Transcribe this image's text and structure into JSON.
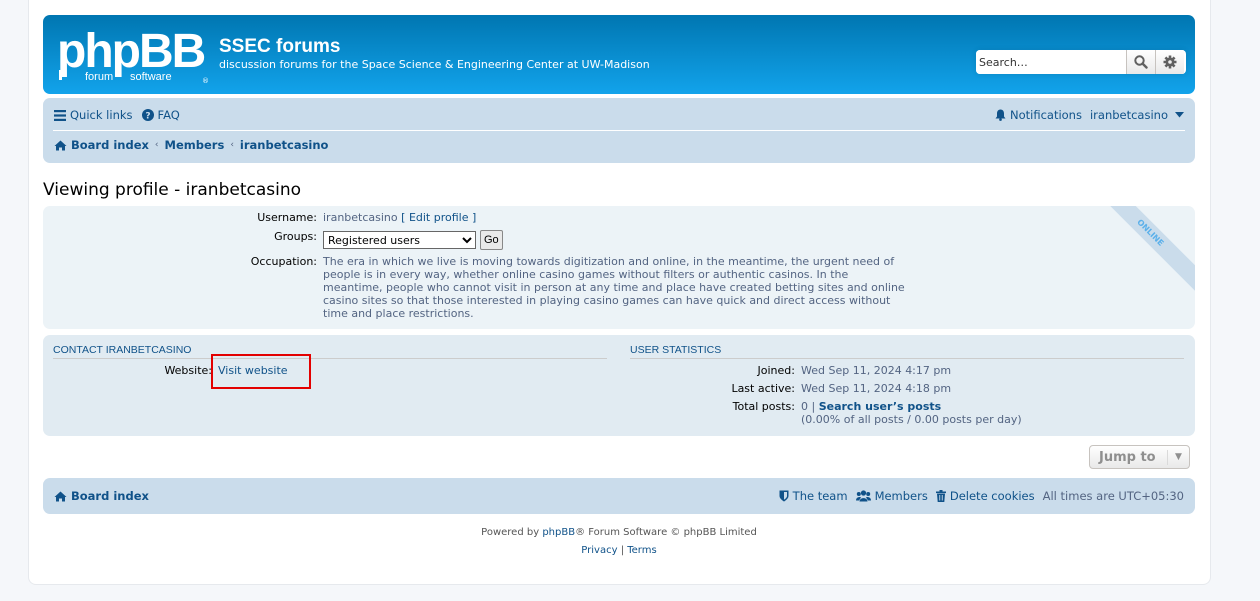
{
  "header": {
    "logo": {
      "main": "phpBB",
      "sub_left": "forum",
      "sub_right": "software"
    },
    "site_title": "SSEC forums",
    "site_description": "discussion forums for the Space Science & Engineering Center at UW-Madison",
    "search": {
      "placeholder": "Search…",
      "value": "",
      "search_icon": "search-icon",
      "settings_icon": "gear-icon"
    }
  },
  "navbar": {
    "quick_links": "Quick links",
    "faq": "FAQ",
    "notifications": "Notifications",
    "username": "iranbetcasino",
    "breadcrumbs": [
      "Board index",
      "Members",
      "iranbetcasino"
    ]
  },
  "page": {
    "title": "Viewing profile - iranbetcasino"
  },
  "profile": {
    "status_ribbon": "ONLINE",
    "fields": {
      "username_label": "Username:",
      "username_value": "iranbetcasino",
      "edit_profile": "Edit profile",
      "groups_label": "Groups:",
      "groups_selected": "Registered users",
      "go_button": "Go",
      "occupation_label": "Occupation:",
      "occupation_value": "The era in which we live is moving towards digitization and online, in the meantime, the urgent need of people is in every way, whether online casino games without filters or authentic casinos. In the meantime, people who cannot visit in person at any time and place have created betting sites and online casino sites so that those interested in playing casino games can have quick and direct access without time and place restrictions."
    }
  },
  "contact": {
    "heading": "CONTACT IRANBETCASINO",
    "website_label": "Website:",
    "website_link": "Visit website"
  },
  "statistics": {
    "heading": "USER STATISTICS",
    "joined_label": "Joined:",
    "joined_value": "Wed Sep 11, 2024 4:17 pm",
    "last_active_label": "Last active:",
    "last_active_value": "Wed Sep 11, 2024 4:18 pm",
    "total_posts_label": "Total posts:",
    "total_posts_value": "0",
    "search_posts_link": "Search user’s posts",
    "posts_detail": "(0.00% of all posts / 0.00 posts per day)"
  },
  "jump_to": {
    "label": "Jump to"
  },
  "footer_nav": {
    "board_index": "Board index",
    "the_team": "The team",
    "members": "Members",
    "delete_cookies": "Delete cookies",
    "timezone": "All times are UTC+05:30"
  },
  "copyright": {
    "powered_prefix": "Powered by ",
    "phpbb_link": "phpBB",
    "powered_suffix": "® Forum Software © phpBB Limited",
    "privacy": "Privacy",
    "separator": "|",
    "terms": "Terms"
  },
  "highlight": {
    "color": "#e30000",
    "target": "Visit website"
  }
}
